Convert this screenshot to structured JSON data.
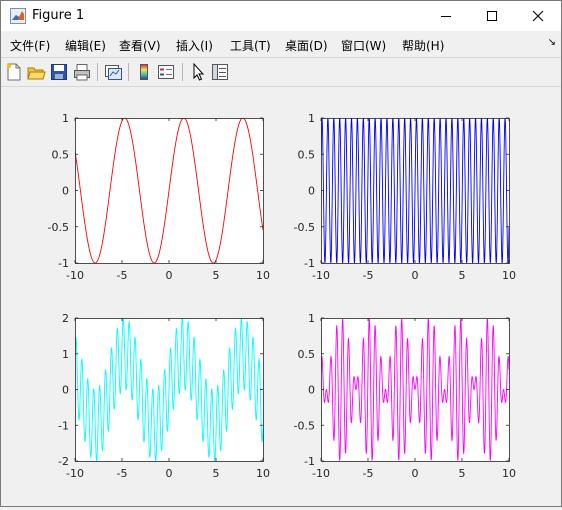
{
  "window": {
    "title": "Figure 1"
  },
  "menu": [
    "文件(F)",
    "编辑(E)",
    "查看(V)",
    "插入(I)",
    "工具(T)",
    "桌面(D)",
    "窗口(W)",
    "帮助(H)"
  ],
  "toolbar": [
    "new-figure",
    "open-file",
    "save",
    "print",
    "link-plot",
    "insert-colorbar",
    "insert-legend",
    "edit-plot",
    "property-inspector"
  ],
  "chart_data": [
    {
      "type": "line",
      "color": "#ff0000",
      "function": "sin(x)",
      "xlim": [
        -10,
        10
      ],
      "ylim": [
        -1,
        1
      ],
      "xticks": [
        "-10",
        "-5",
        "0",
        "5",
        "10"
      ],
      "yticks": [
        "1",
        "0.5",
        "0",
        "-0.5",
        "-1"
      ]
    },
    {
      "type": "line",
      "color": "#0000ff",
      "function": "sin(10x)",
      "xlim": [
        -10,
        10
      ],
      "ylim": [
        -1,
        1
      ],
      "xticks": [
        "-10",
        "-5",
        "0",
        "5",
        "10"
      ],
      "yticks": [
        "1",
        "0.5",
        "0",
        "-0.5",
        "-1"
      ]
    },
    {
      "type": "line",
      "color": "#00ffff",
      "function": "sin(x)+sin(10x)",
      "xlim": [
        -10,
        10
      ],
      "ylim": [
        -2,
        2
      ],
      "xticks": [
        "-10",
        "-5",
        "0",
        "5",
        "10"
      ],
      "yticks": [
        "2",
        "1",
        "0",
        "-1",
        "-2"
      ]
    },
    {
      "type": "line",
      "color": "#ff00ff",
      "function": "sin(x)*sin(10x)",
      "xlim": [
        -10,
        10
      ],
      "ylim": [
        -1,
        1
      ],
      "xticks": [
        "-10",
        "-5",
        "0",
        "5",
        "10"
      ],
      "yticks": [
        "1",
        "0.5",
        "0",
        "-0.5",
        "-1"
      ]
    }
  ]
}
